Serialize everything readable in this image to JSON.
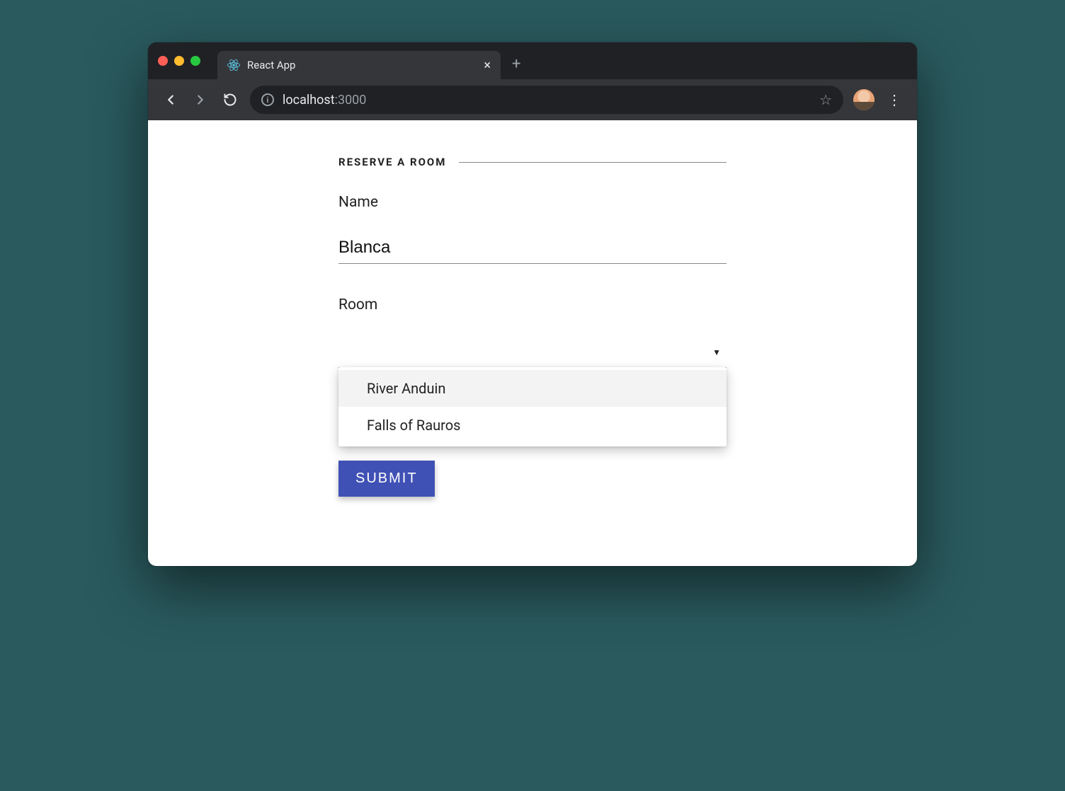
{
  "browser": {
    "tab_title": "React App",
    "url_host": "localhost",
    "url_port": ":3000"
  },
  "form": {
    "legend": "RESERVE A ROOM",
    "name_label": "Name",
    "name_value": "Blanca",
    "room_label": "Room",
    "room_value": "",
    "room_options": [
      "River Anduin",
      "Falls of Rauros"
    ],
    "submit_label": "SUBMIT"
  },
  "colors": {
    "accent": "#3f51b5"
  }
}
